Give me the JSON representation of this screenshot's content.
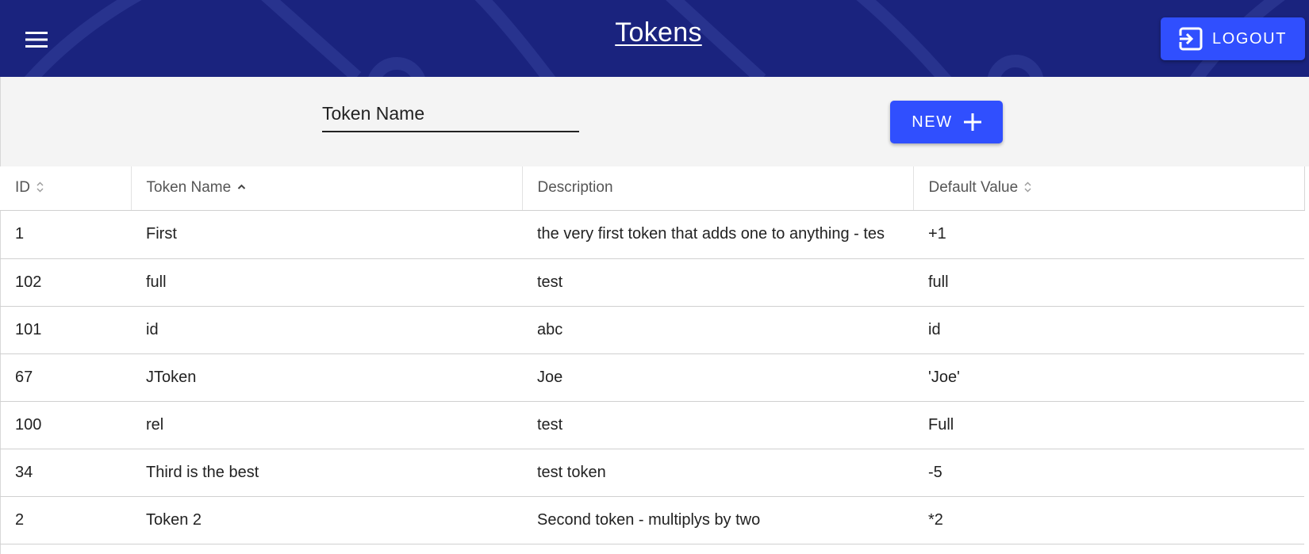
{
  "header": {
    "title": "Tokens",
    "logout_label": "LOGOUT",
    "background_color": "#1a237e",
    "accent_color": "#304ffe"
  },
  "filter": {
    "name_placeholder": "Token Name",
    "name_value": "",
    "new_label": "NEW"
  },
  "table": {
    "columns": [
      {
        "label": "ID",
        "sort": "none"
      },
      {
        "label": "Token Name",
        "sort": "ascending"
      },
      {
        "label": "Description",
        "sort": "not-sortable"
      },
      {
        "label": "Default Value",
        "sort": "none"
      }
    ],
    "rows": [
      {
        "id": "1",
        "name": "First",
        "description": "the very first token that adds one to anything - tes",
        "default": "+1"
      },
      {
        "id": "102",
        "name": "full",
        "description": "test",
        "default": "full"
      },
      {
        "id": "101",
        "name": "id",
        "description": "abc",
        "default": "id"
      },
      {
        "id": "67",
        "name": "JToken",
        "description": "Joe",
        "default": "'Joe'"
      },
      {
        "id": "100",
        "name": "rel",
        "description": "test",
        "default": "Full"
      },
      {
        "id": "34",
        "name": "Third is the best",
        "description": "test token",
        "default": "-5"
      },
      {
        "id": "2",
        "name": "Token 2",
        "description": "Second token - multiplys by two",
        "default": "*2"
      }
    ]
  },
  "icons": {
    "menu": "menu-icon",
    "logout": "logout-icon",
    "new": "plus-icon",
    "sort_unsorted": "sort-icon",
    "sort_ascending": "sort-ascending-icon"
  }
}
